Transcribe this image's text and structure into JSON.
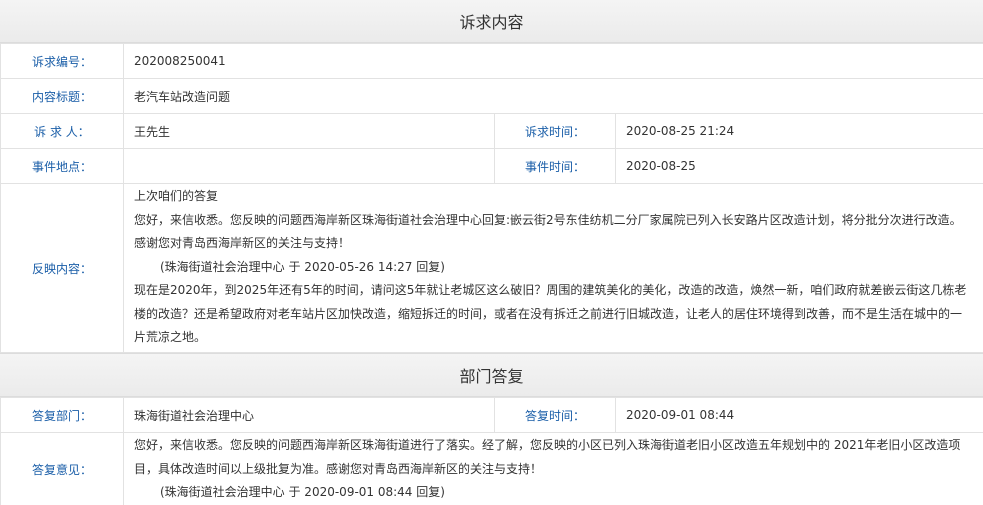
{
  "complaint_section": {
    "title": "诉求内容",
    "rows": {
      "number": {
        "label": "诉求编号：",
        "value": "202008250041"
      },
      "subject": {
        "label": "内容标题：",
        "value": "老汽车站改造问题"
      },
      "person": {
        "label": "诉 求 人：",
        "value": "王先生"
      },
      "time": {
        "label": "诉求时间：",
        "value": "2020-08-25 21:24"
      },
      "location": {
        "label": "事件地点：",
        "value": ""
      },
      "event_time": {
        "label": "事件时间：",
        "value": "2020-08-25"
      },
      "feedback": {
        "label": "反映内容：",
        "lines": [
          "上次咱们的答复",
          "您好，来信收悉。您反映的问题西海岸新区珠海街道社会治理中心回复:嵌云街2号东佳纺机二分厂家属院已列入长安路片区改造计划，将分批分次进行改造。 感谢您对青岛西海岸新区的关注与支持！",
          "(珠海街道社会治理中心 于 2020-05-26 14:27 回复)",
          "现在是2020年，到2025年还有5年的时间，请问这5年就让老城区这么破旧？周围的建筑美化的美化，改造的改造，焕然一新，咱们政府就差嵌云街这几栋老楼的改造？还是希望政府对老车站片区加快改造，缩短拆迁的时间，或者在没有拆迁之前进行旧城改造，让老人的居住环境得到改善，而不是生活在城中的一片荒凉之地。"
        ]
      }
    }
  },
  "reply_section": {
    "title": "部门答复",
    "rows": {
      "department": {
        "label": "答复部门：",
        "value": "珠海街道社会治理中心"
      },
      "reply_time": {
        "label": "答复时间：",
        "value": "2020-09-01 08:44"
      },
      "opinion": {
        "label": "答复意见：",
        "lines": [
          "您好，来信收悉。您反映的问题西海岸新区珠海街道进行了落实。经了解，您反映的小区已列入珠海街道老旧小区改造五年规划中的 2021年老旧小区改造项目，具体改造时间以上级批复为准。感谢您对青岛西海岸新区的关注与支持！",
          "(珠海街道社会治理中心 于 2020-09-01 08:44 回复)"
        ]
      }
    }
  }
}
